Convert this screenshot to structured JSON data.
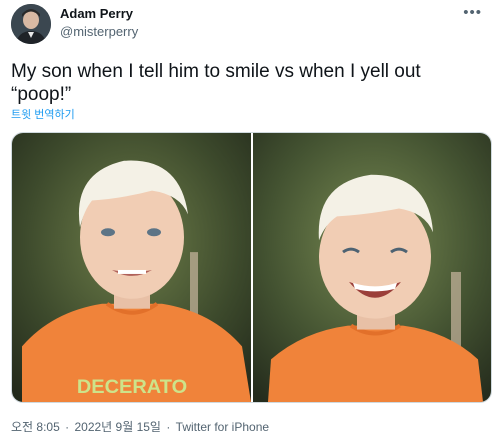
{
  "author": {
    "name": "Adam Perry",
    "handle": "@misterperry",
    "avatar_icon": "profile-photo",
    "more_icon": "more-options-icon"
  },
  "tweet": {
    "text": "My son when I tell him to smile vs when I yell out “poop!”",
    "translate_label": "트윗 번역하기",
    "shirt_text": "DECERATO"
  },
  "meta": {
    "time": "오전 8:05",
    "separator": "·",
    "date": "2022년 9월 15일",
    "client": "Twitter for iPhone"
  },
  "colors": {
    "accent": "#1d9bf0",
    "secondary_text": "#536471",
    "shirt": "#f0833a"
  }
}
